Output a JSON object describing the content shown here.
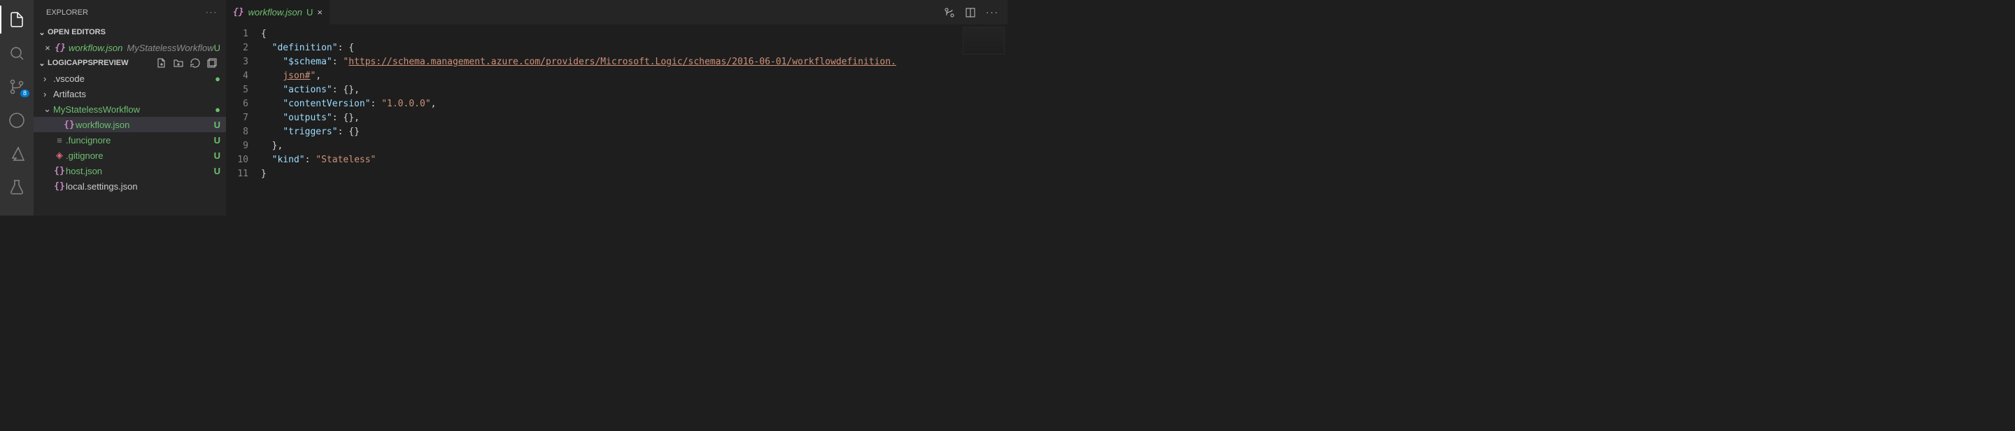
{
  "explorer": {
    "title": "EXPLORER",
    "openEditors": {
      "label": "OPEN EDITORS",
      "item": {
        "name": "workflow.json",
        "path": "MyStatelessWorkflow",
        "status": "U"
      }
    },
    "workspace": {
      "name": "LOGICAPPSPREVIEW",
      "tree": [
        {
          "name": ".vscode",
          "type": "folder",
          "marker": "dot"
        },
        {
          "name": "Artifacts",
          "type": "folder",
          "marker": ""
        },
        {
          "name": "MyStatelessWorkflow",
          "type": "folder",
          "marker": "dot",
          "expanded": true,
          "color": "green"
        },
        {
          "name": "workflow.json",
          "type": "json",
          "marker": "U",
          "color": "green",
          "indent": 2,
          "selected": true
        },
        {
          "name": ".funcignore",
          "type": "file",
          "marker": "U",
          "color": "green"
        },
        {
          "name": ".gitignore",
          "type": "git",
          "marker": "U",
          "color": "green"
        },
        {
          "name": "host.json",
          "type": "json",
          "marker": "U",
          "color": "green"
        },
        {
          "name": "local.settings.json",
          "type": "json",
          "marker": ""
        }
      ]
    },
    "sourceControlBadge": "8"
  },
  "tab": {
    "name": "workflow.json",
    "status": "U"
  },
  "code": {
    "lines": [
      {
        "n": 1,
        "tokens": [
          {
            "t": "{",
            "c": "b"
          }
        ]
      },
      {
        "n": 2,
        "tokens": [
          {
            "t": "  ",
            "c": "b"
          },
          {
            "t": "\"definition\"",
            "c": "k"
          },
          {
            "t": ": {",
            "c": "b"
          }
        ]
      },
      {
        "n": 3,
        "tokens": [
          {
            "t": "    ",
            "c": "b"
          },
          {
            "t": "\"$schema\"",
            "c": "k"
          },
          {
            "t": ": ",
            "c": "b"
          },
          {
            "t": "\"",
            "c": "s"
          },
          {
            "t": "https://schema.management.azure.com/providers/Microsoft.Logic/schemas/2016-06-01/workflowdefinition.",
            "c": "u"
          }
        ]
      },
      {
        "n": "",
        "tokens": [
          {
            "t": "    ",
            "c": "b"
          },
          {
            "t": "json#",
            "c": "u"
          },
          {
            "t": "\"",
            "c": "s"
          },
          {
            "t": ",",
            "c": "b"
          }
        ]
      },
      {
        "n": 4,
        "tokens": [
          {
            "t": "    ",
            "c": "b"
          },
          {
            "t": "\"actions\"",
            "c": "k"
          },
          {
            "t": ": {},",
            "c": "b"
          }
        ]
      },
      {
        "n": 5,
        "tokens": [
          {
            "t": "    ",
            "c": "b"
          },
          {
            "t": "\"contentVersion\"",
            "c": "k"
          },
          {
            "t": ": ",
            "c": "b"
          },
          {
            "t": "\"1.0.0.0\"",
            "c": "s"
          },
          {
            "t": ",",
            "c": "b"
          }
        ]
      },
      {
        "n": 6,
        "tokens": [
          {
            "t": "    ",
            "c": "b"
          },
          {
            "t": "\"outputs\"",
            "c": "k"
          },
          {
            "t": ": {},",
            "c": "b"
          }
        ]
      },
      {
        "n": 7,
        "tokens": [
          {
            "t": "    ",
            "c": "b"
          },
          {
            "t": "\"triggers\"",
            "c": "k"
          },
          {
            "t": ": {}",
            "c": "b"
          }
        ]
      },
      {
        "n": 8,
        "tokens": [
          {
            "t": "  },",
            "c": "b"
          }
        ]
      },
      {
        "n": 9,
        "tokens": [
          {
            "t": "  ",
            "c": "b"
          },
          {
            "t": "\"kind\"",
            "c": "k"
          },
          {
            "t": ": ",
            "c": "b"
          },
          {
            "t": "\"Stateless\"",
            "c": "s"
          }
        ]
      },
      {
        "n": 10,
        "tokens": [
          {
            "t": "}",
            "c": "b"
          }
        ]
      },
      {
        "n": 11,
        "tokens": []
      }
    ]
  }
}
